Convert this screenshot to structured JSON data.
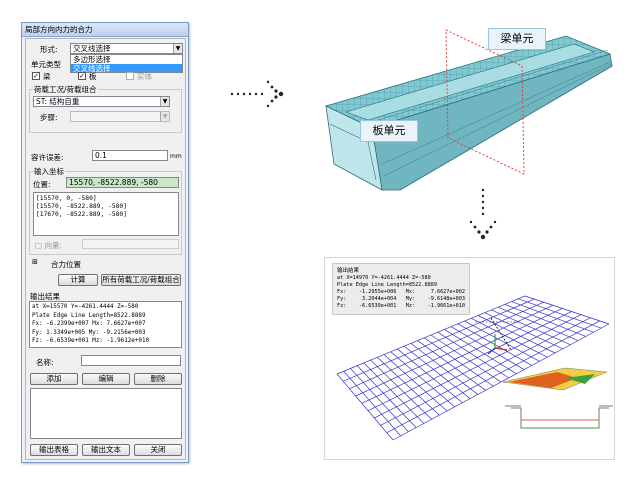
{
  "dialog": {
    "title": "局部方向内力的合力",
    "form_label": "形式:",
    "form_value": "交叉线选择",
    "form_options": [
      "多边形选择",
      "交叉线选择"
    ],
    "element_type_label": "单元类型",
    "check_beam": "梁",
    "check_plate": "板",
    "check_solid": "实体",
    "check_mark": "✓",
    "loadcase_group": "荷载工况/荷载组合",
    "loadcase_value": "ST: 结构自重",
    "step_label": "步骤:",
    "tolerance_label": "容许误差:",
    "tolerance_value": "0.1",
    "tolerance_unit": "mm",
    "coord_group": "输入坐标",
    "position_label": "位置:",
    "position_value": "15570, -8522.889, -580",
    "coord_list": [
      "[15570, 0, -580]",
      "[15570, -8522.889, -580]",
      "[17670, -8522.889, -580]"
    ],
    "direction_label": "□ 向量:",
    "resultant_pos": "合力位置",
    "expand_icon_text": "⊞",
    "calc_button": "计算",
    "all_loads_button": "所有荷载工况/荷载组合",
    "output_label": "输出结果",
    "output_lines": [
      "at X=15570 Y=-4261.4444 Z=-580",
      "Plate Edge Line Length=8522.8889",
      "Fx:   -6.2399e+007   Mx:     7.6627e+007",
      "Fy:    1.3349e+005   My:    -9.2156e+003",
      "Fz:   -6.6539e+001   Mz:    -1.9612e+010"
    ],
    "name_label": "名称:",
    "add_button": "添加",
    "edit_button": "编辑",
    "delete_button": "删除",
    "export_table_button": "输出表格",
    "export_text_button": "输出文本",
    "close_button": "关闭"
  },
  "callouts": {
    "beam_element": "梁单元",
    "plate_element": "板单元"
  },
  "result_panel": {
    "title": "输出结果",
    "lines": [
      "at X=14970 Y=-4261.4444 Z=-580",
      "Plate Edge Line Length=8522.8889",
      "Fx:    -1.2955e+006   Mx:     7.6627e+002",
      "Fy:     3.2044e+004   My:    -9.6148e+003",
      "Fz:    -6.6539e+001   Mz:    -1.9661e+010"
    ]
  },
  "colors": {
    "model": "#7ec8d0",
    "model_edge": "#2f6f7c",
    "mesh": "#3c3ccf",
    "section_plane": "#e04040"
  }
}
